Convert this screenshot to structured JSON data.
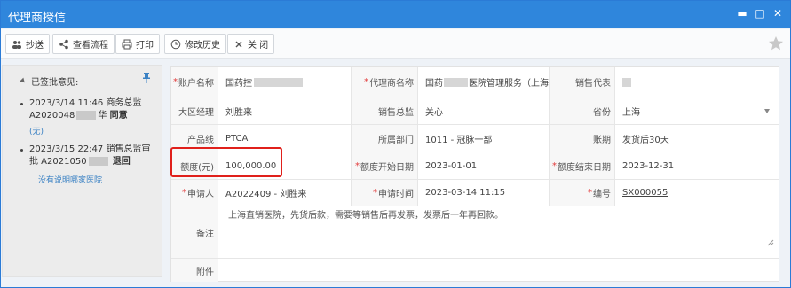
{
  "window": {
    "title": "代理商授信"
  },
  "toolbar": {
    "copy_label": "抄送",
    "flow_label": "查看流程",
    "print_label": "打印",
    "history_label": "修改历史",
    "close_label": "关 闭"
  },
  "left_panel": {
    "header": "已签批意见:",
    "records": [
      {
        "line1": "2023/3/14 11:46 商务总监",
        "line2_prefix": "A2020048",
        "line2_suffix": "华",
        "result": "同意",
        "sub": "(无)"
      },
      {
        "line1": "2023/3/15 22:47 销售总监审",
        "line2_prefix": "批 A2021050",
        "line2_suffix": "",
        "result": "退回",
        "sub": "没有说明哪家医院"
      }
    ]
  },
  "form": {
    "rows": [
      {
        "c1": {
          "label": "账户名称",
          "required": true,
          "value": "国药控"
        },
        "c2": {
          "label": "代理商名称",
          "required": true,
          "value_prefix": "国药",
          "value_suffix": "医院管理服务（上海"
        },
        "c3": {
          "label": "销售代表",
          "required": false,
          "value": ""
        }
      },
      {
        "c1": {
          "label": "大区经理",
          "required": false,
          "value": "刘胜来"
        },
        "c2": {
          "label": "销售总监",
          "required": false,
          "value": "关心"
        },
        "c3": {
          "label": "省份",
          "required": false,
          "value": "上海"
        }
      },
      {
        "c1": {
          "label": "产品线",
          "required": false,
          "value": "PTCA"
        },
        "c2": {
          "label": "所属部门",
          "required": false,
          "value": "1011 - 冠脉一部"
        },
        "c3": {
          "label": "账期",
          "required": false,
          "value": "发货后30天"
        }
      },
      {
        "c1": {
          "label": "额度(元)",
          "required": false,
          "value": "100,000.00"
        },
        "c2": {
          "label": "额度开始日期",
          "required": true,
          "value": "2023-01-01"
        },
        "c3": {
          "label": "额度结束日期",
          "required": true,
          "value": "2023-12-31"
        }
      },
      {
        "c1": {
          "label": "申请人",
          "required": true,
          "value": "A2022409 - 刘胜来"
        },
        "c2": {
          "label": "申请时间",
          "required": true,
          "value": "2023-03-14 11:15"
        },
        "c3": {
          "label": "编号",
          "required": true,
          "value": "SX000055"
        }
      }
    ],
    "remark_label": "备注",
    "remark_value": "上海直销医院，先货后款，需要等销售后再发票，发票后一年再回款。",
    "attachment_label": "附件"
  },
  "colors": {
    "titlebar": "#2f86dc",
    "required": "#e23b3b",
    "highlight_frame": "#e0201b"
  }
}
